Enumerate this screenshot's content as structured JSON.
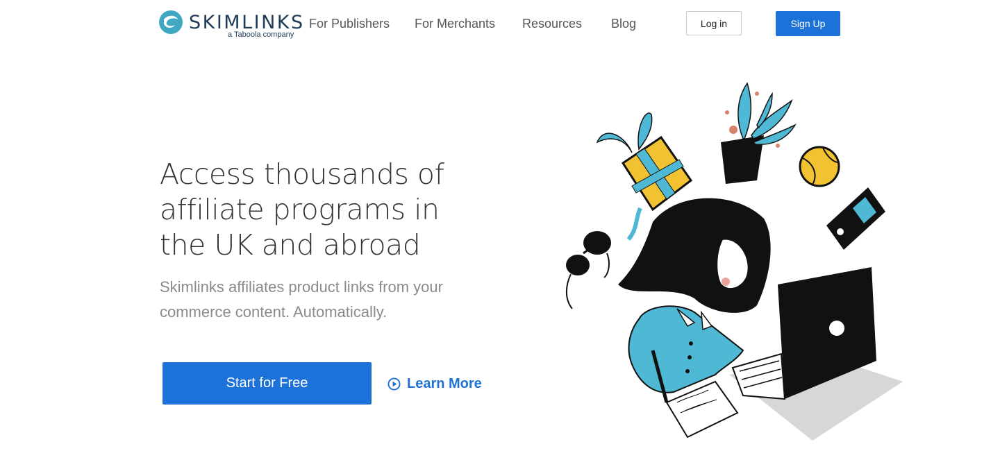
{
  "header": {
    "logo": {
      "wordmark": "SKIMLINKS",
      "tagline": "a Taboola company",
      "icon": "skimlinks-logo-icon"
    },
    "nav": [
      {
        "label": "For Publishers"
      },
      {
        "label": "For Merchants"
      },
      {
        "label": "Resources"
      },
      {
        "label": "Blog"
      }
    ],
    "login_label": "Log in",
    "signup_label": "Sign Up"
  },
  "hero": {
    "title": "Access thousands of affiliate programs in the UK and abroad",
    "subtitle": "Skimlinks affiliates product links from your commerce content. Automatically.",
    "cta_primary": "Start for Free",
    "cta_secondary": "Learn More",
    "cta_secondary_icon": "play-circle-icon",
    "illustration": "woman-working-on-laptop-illustration"
  },
  "colors": {
    "accent": "#1c72d8",
    "brand_teal": "#41a8c4",
    "brand_navy": "#1f3b57",
    "illustration_blue": "#4fb8d4",
    "illustration_yellow": "#f1c232"
  }
}
